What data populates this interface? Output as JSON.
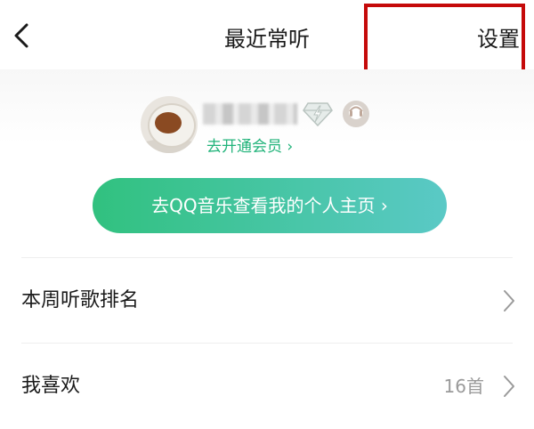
{
  "header": {
    "title": "最近常听",
    "settings_label": "设置"
  },
  "profile": {
    "vip_link": "去开通会员 ›",
    "homepage_button": "去QQ音乐查看我的个人主页 ›"
  },
  "rows": [
    {
      "label": "本周听歌排名",
      "value": ""
    },
    {
      "label": "我喜欢",
      "value": "16首"
    }
  ],
  "colors": {
    "accent": "#21b37a",
    "highlight": "#c50a0a",
    "button_gradient_start": "#31c17f",
    "button_gradient_end": "#5ac9c6"
  },
  "icons": {
    "back": "chevron-left-icon",
    "member": "diamond-icon",
    "badge": "music-badge-icon",
    "row_arrow": "chevron-right-icon"
  }
}
